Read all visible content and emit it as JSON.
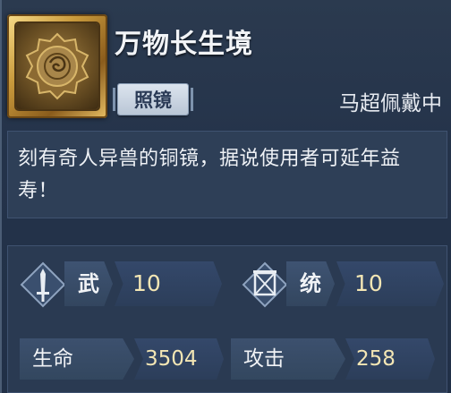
{
  "item": {
    "name": "万物长生境",
    "type": "照镜",
    "wearer": "马超佩戴中",
    "description": "刻有奇人异兽的铜镜，据说使用者可延年益寿！",
    "icon": "bronze-mirror-icon"
  },
  "stats": {
    "primary": [
      {
        "label": "武",
        "value": "10",
        "icon": "sword-icon"
      },
      {
        "label": "统",
        "value": "10",
        "icon": "banner-icon"
      }
    ],
    "secondary": [
      {
        "label": "生命",
        "value": "3504"
      },
      {
        "label": "攻击",
        "value": "258"
      }
    ]
  },
  "colors": {
    "value_text": "#f3e6b4",
    "frame_gold": "#c99a3c",
    "panel_bg": "#24334a"
  }
}
